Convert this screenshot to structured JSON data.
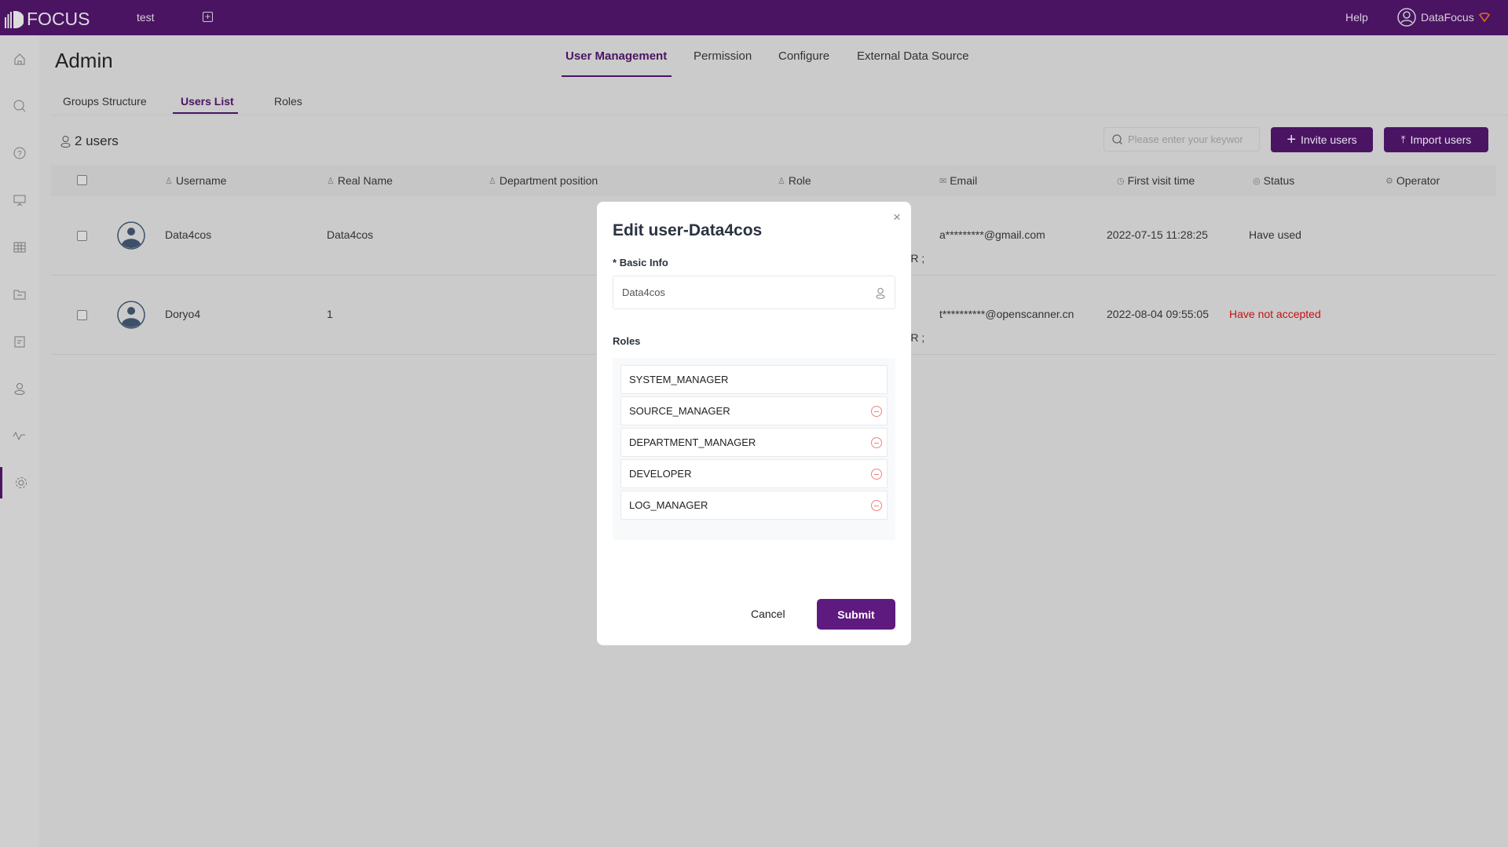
{
  "topbar": {
    "logo": "FOCUS",
    "workspace_tab": "test",
    "help": "Help",
    "username": "DataFocus",
    "brand_color": "#4a1463",
    "gem_color": "#e07020"
  },
  "sidebar": {
    "items": [
      "home-icon",
      "search-icon",
      "help-icon",
      "presentation-icon",
      "table-icon",
      "folder-icon",
      "clipboard-icon",
      "user-icon",
      "activity-icon",
      "settings-icon"
    ],
    "active": "settings-icon"
  },
  "page": {
    "title": "Admin",
    "main_tabs": [
      "User Management",
      "Permission",
      "Configure",
      "External Data Source"
    ],
    "active_main_tab": "User Management",
    "sub_tabs": [
      "Groups Structure",
      "Users List",
      "Roles"
    ],
    "active_sub_tab": "Users List",
    "user_count": "2 users"
  },
  "toolbar": {
    "search_placeholder": "Please enter your keywor",
    "invite": "Invite users",
    "import": "Import users"
  },
  "table": {
    "headers": [
      "Username",
      "Real Name",
      "Department position",
      "Role",
      "Email",
      "First visit time",
      "Status",
      "Operator"
    ],
    "rows": [
      {
        "username": "Data4cos",
        "real_name": "Data4cos",
        "role": "ER ;",
        "email": "a*********@gmail.com",
        "first_visit": "2022-07-15 11:28:25",
        "status": "Have used",
        "status_color": "#333333"
      },
      {
        "username": "Doryo4",
        "real_name": "1",
        "role": "ER ;",
        "email": "t**********@openscanner.cn",
        "first_visit": "2022-08-04 09:55:05",
        "status": "Have not accepted",
        "status_color": "#c81010"
      }
    ]
  },
  "modal": {
    "title": "Edit user-Data4cos",
    "basic_info_label": "Basic Info",
    "required_mark": "*",
    "username_value": "Data4cos",
    "roles_label": "Roles",
    "roles": [
      "SYSTEM_MANAGER",
      "SOURCE_MANAGER",
      "DEPARTMENT_MANAGER",
      "DEVELOPER",
      "LOG_MANAGER"
    ],
    "cancel": "Cancel",
    "submit": "Submit",
    "submit_color": "#5e1a7e"
  }
}
